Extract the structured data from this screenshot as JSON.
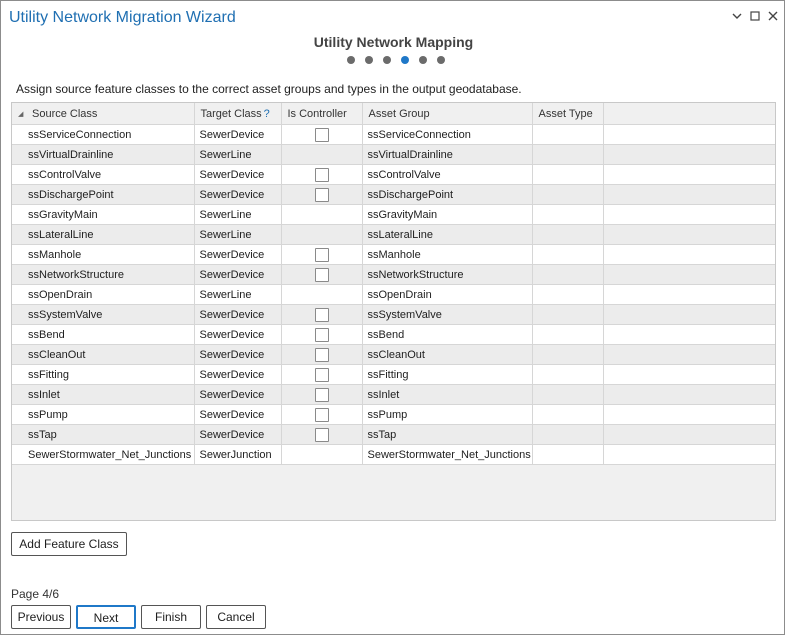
{
  "window": {
    "title": "Utility Network Migration Wizard",
    "collapse_icon": "chevron-down-icon",
    "maximize_icon": "maximize-icon",
    "close_icon": "close-icon"
  },
  "step": {
    "title": "Utility Network Mapping",
    "total": 6,
    "current": 4
  },
  "instructions": "Assign source feature classes to the correct asset groups and types in the output geodatabase.",
  "table": {
    "columns": {
      "source_class": "Source Class",
      "target_class": "Target Class",
      "target_class_help": "?",
      "is_controller": "Is Controller",
      "asset_group": "Asset Group",
      "asset_type": "Asset Type"
    },
    "rows": [
      {
        "source": "ssServiceConnection",
        "target": "SewerDevice",
        "has_controller_checkbox": true,
        "controller_checked": false,
        "asset_group": "ssServiceConnection",
        "asset_type": ""
      },
      {
        "source": "ssVirtualDrainline",
        "target": "SewerLine",
        "has_controller_checkbox": false,
        "controller_checked": false,
        "asset_group": "ssVirtualDrainline",
        "asset_type": ""
      },
      {
        "source": "ssControlValve",
        "target": "SewerDevice",
        "has_controller_checkbox": true,
        "controller_checked": false,
        "asset_group": "ssControlValve",
        "asset_type": ""
      },
      {
        "source": "ssDischargePoint",
        "target": "SewerDevice",
        "has_controller_checkbox": true,
        "controller_checked": false,
        "asset_group": "ssDischargePoint",
        "asset_type": ""
      },
      {
        "source": "ssGravityMain",
        "target": "SewerLine",
        "has_controller_checkbox": false,
        "controller_checked": false,
        "asset_group": "ssGravityMain",
        "asset_type": ""
      },
      {
        "source": "ssLateralLine",
        "target": "SewerLine",
        "has_controller_checkbox": false,
        "controller_checked": false,
        "asset_group": "ssLateralLine",
        "asset_type": ""
      },
      {
        "source": "ssManhole",
        "target": "SewerDevice",
        "has_controller_checkbox": true,
        "controller_checked": false,
        "asset_group": "ssManhole",
        "asset_type": ""
      },
      {
        "source": "ssNetworkStructure",
        "target": "SewerDevice",
        "has_controller_checkbox": true,
        "controller_checked": false,
        "asset_group": "ssNetworkStructure",
        "asset_type": ""
      },
      {
        "source": "ssOpenDrain",
        "target": "SewerLine",
        "has_controller_checkbox": false,
        "controller_checked": false,
        "asset_group": "ssOpenDrain",
        "asset_type": ""
      },
      {
        "source": "ssSystemValve",
        "target": "SewerDevice",
        "has_controller_checkbox": true,
        "controller_checked": false,
        "asset_group": "ssSystemValve",
        "asset_type": ""
      },
      {
        "source": "ssBend",
        "target": "SewerDevice",
        "has_controller_checkbox": true,
        "controller_checked": false,
        "asset_group": "ssBend",
        "asset_type": ""
      },
      {
        "source": "ssCleanOut",
        "target": "SewerDevice",
        "has_controller_checkbox": true,
        "controller_checked": false,
        "asset_group": "ssCleanOut",
        "asset_type": ""
      },
      {
        "source": "ssFitting",
        "target": "SewerDevice",
        "has_controller_checkbox": true,
        "controller_checked": false,
        "asset_group": "ssFitting",
        "asset_type": ""
      },
      {
        "source": "ssInlet",
        "target": "SewerDevice",
        "has_controller_checkbox": true,
        "controller_checked": false,
        "asset_group": "ssInlet",
        "asset_type": ""
      },
      {
        "source": "ssPump",
        "target": "SewerDevice",
        "has_controller_checkbox": true,
        "controller_checked": false,
        "asset_group": "ssPump",
        "asset_type": ""
      },
      {
        "source": "ssTap",
        "target": "SewerDevice",
        "has_controller_checkbox": true,
        "controller_checked": false,
        "asset_group": "ssTap",
        "asset_type": ""
      },
      {
        "source": "SewerStormwater_Net_Junctions",
        "target": "SewerJunction",
        "has_controller_checkbox": false,
        "controller_checked": false,
        "asset_group": "SewerStormwater_Net_Junctions",
        "asset_type": ""
      }
    ]
  },
  "buttons": {
    "add_feature_class": "Add Feature Class",
    "previous": "Previous",
    "next": "Next",
    "finish": "Finish",
    "cancel": "Cancel"
  },
  "footer": {
    "page_label": "Page 4/6"
  },
  "colors": {
    "title": "#1f6fb2",
    "active_step": "#1f78c8",
    "inactive_step": "#6b6b6b",
    "row_alt": "#ececec"
  }
}
